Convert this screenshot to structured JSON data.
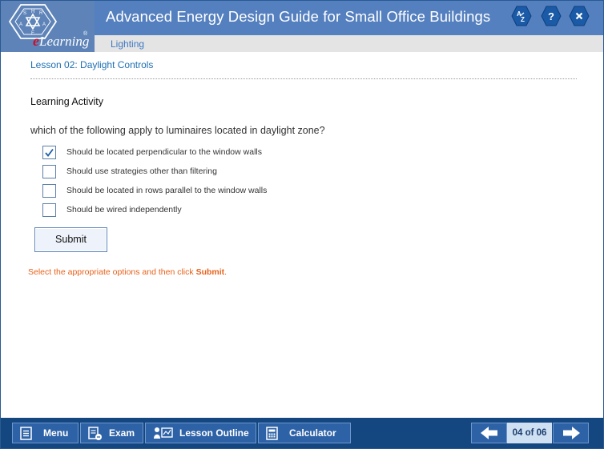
{
  "header": {
    "logo_letters": [
      "A",
      "S",
      "H",
      "R",
      "A",
      "E"
    ],
    "logo_text_e": "e",
    "logo_text_rest": "Learning",
    "logo_reg": "®",
    "title": "Advanced Energy Design Guide for Small Office Buildings",
    "subtitle": "Lighting",
    "buttons": [
      {
        "name": "glossary",
        "label": "AZ"
      },
      {
        "name": "help",
        "label": "?"
      },
      {
        "name": "close",
        "label": "×"
      }
    ]
  },
  "content": {
    "lesson_title": "Lesson 02: Daylight Controls",
    "activity_heading": "Learning Activity",
    "question": "which of the following apply to luminaires located in daylight zone?",
    "options": [
      {
        "label": "Should be located perpendicular to the window walls",
        "checked": true
      },
      {
        "label": "Should use strategies other than filtering",
        "checked": false
      },
      {
        "label": "Should be located in rows parallel to the window walls",
        "checked": false
      },
      {
        "label": "Should be wired independently",
        "checked": false
      }
    ],
    "submit_label": "Submit",
    "hint_prefix": "Select the appropriate options and  then click ",
    "hint_bold": "Submit",
    "hint_suffix": "."
  },
  "footer": {
    "menu_label": "Menu",
    "exam_label": "Exam",
    "outline_label": "Lesson Outline",
    "calculator_label": "Calculator",
    "page_indicator": "04 of 06"
  },
  "colors": {
    "title_bar": "#5580bf",
    "footer_bar": "#14467f",
    "lesson_text": "#1d6fb3",
    "hint_text": "#e8611a",
    "check_mark": "#1f5fa8"
  }
}
